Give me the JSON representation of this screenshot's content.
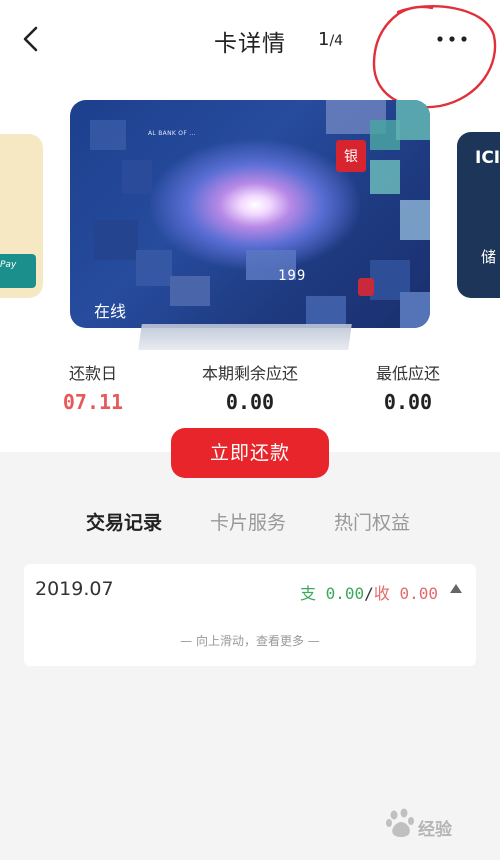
{
  "header": {
    "title": "卡详情",
    "page_current": "1",
    "page_total": "/4",
    "annotation_color": "#e2303a"
  },
  "cards": {
    "left_badge": "Pay",
    "main_online_label": "在线",
    "main_number_fragment": "199",
    "main_union_mark": "银",
    "right_top_label": "ICI",
    "right_bottom_label": "储"
  },
  "stats": {
    "repay_day_label": "还款日",
    "repay_day_value": "07.11",
    "remaining_label": "本期剩余应还",
    "remaining_value": "0.00",
    "min_label": "最低应还",
    "min_value": "0.00"
  },
  "pay_button": {
    "label": "立即还款"
  },
  "tabs": [
    {
      "label": "交易记录",
      "active": true
    },
    {
      "label": "卡片服务",
      "active": false
    },
    {
      "label": "热门权益",
      "active": false
    }
  ],
  "record": {
    "month": "2019.07",
    "expense_label": "支",
    "expense_value": "0.00",
    "separator": "/",
    "income_label": "收",
    "income_value": "0.00",
    "hint": "— 向上滑动，查看更多 —"
  },
  "colors": {
    "accent_red": "#e8252a",
    "value_red": "#e8595a",
    "expense_green": "#3ea85a"
  },
  "watermark": {
    "text": "经验"
  }
}
